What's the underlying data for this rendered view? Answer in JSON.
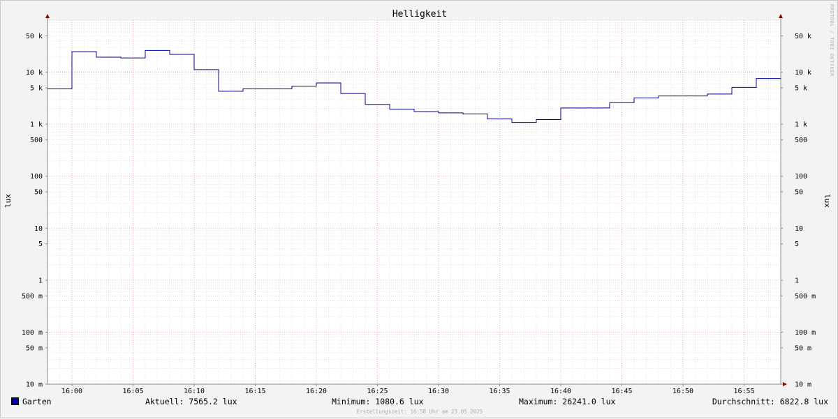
{
  "chart_data": {
    "type": "line",
    "title": "Helligkeit",
    "ylabel_left": "lux",
    "ylabel_right": "lux",
    "yscale": "log",
    "ylim": [
      0.01,
      100000
    ],
    "xlim": [
      "15:58",
      "17:58"
    ],
    "x_ticks": [
      "16:00",
      "16:05",
      "16:10",
      "16:15",
      "16:20",
      "16:25",
      "16:30",
      "16:35",
      "16:40",
      "16:45",
      "16:50",
      "16:55"
    ],
    "y_ticks": [
      {
        "value": 0.01,
        "label": "10 m"
      },
      {
        "value": 0.05,
        "label": "50 m"
      },
      {
        "value": 0.1,
        "label": "100 m"
      },
      {
        "value": 0.5,
        "label": "500 m"
      },
      {
        "value": 1,
        "label": "1"
      },
      {
        "value": 5,
        "label": "5"
      },
      {
        "value": 10,
        "label": "10"
      },
      {
        "value": 50,
        "label": "50"
      },
      {
        "value": 100,
        "label": "100"
      },
      {
        "value": 500,
        "label": "500"
      },
      {
        "value": 1000,
        "label": "1 k"
      },
      {
        "value": 5000,
        "label": "5 k"
      },
      {
        "value": 10000,
        "label": "10 k"
      },
      {
        "value": 50000,
        "label": "50 k"
      }
    ],
    "grid": true,
    "series": [
      {
        "name": "Garten",
        "color": "#000099",
        "step": true,
        "points": [
          {
            "t": "15:58",
            "v": 4800
          },
          {
            "t": "16:00",
            "v": 24800
          },
          {
            "t": "16:02",
            "v": 19500
          },
          {
            "t": "16:04",
            "v": 18800
          },
          {
            "t": "16:06",
            "v": 26241
          },
          {
            "t": "16:08",
            "v": 22000
          },
          {
            "t": "16:10",
            "v": 11200
          },
          {
            "t": "16:12",
            "v": 4300
          },
          {
            "t": "16:14",
            "v": 4800
          },
          {
            "t": "16:18",
            "v": 5400
          },
          {
            "t": "16:20",
            "v": 6200
          },
          {
            "t": "16:22",
            "v": 3900
          },
          {
            "t": "16:24",
            "v": 2400
          },
          {
            "t": "16:26",
            "v": 1950
          },
          {
            "t": "16:28",
            "v": 1750
          },
          {
            "t": "16:30",
            "v": 1650
          },
          {
            "t": "16:32",
            "v": 1580
          },
          {
            "t": "16:34",
            "v": 1260
          },
          {
            "t": "16:36",
            "v": 1080.6
          },
          {
            "t": "16:38",
            "v": 1230
          },
          {
            "t": "16:40",
            "v": 2050
          },
          {
            "t": "16:44",
            "v": 2600
          },
          {
            "t": "16:46",
            "v": 3200
          },
          {
            "t": "16:48",
            "v": 3500
          },
          {
            "t": "16:52",
            "v": 3800
          },
          {
            "t": "16:54",
            "v": 5100
          },
          {
            "t": "16:56",
            "v": 7565.2
          },
          {
            "t": "16:58",
            "v": 7565.2
          }
        ]
      }
    ],
    "legend": {
      "name": "Garten",
      "current": "Aktuell: 7565.2 lux",
      "minimum": "Minimum: 1080.6 lux",
      "maximum": "Maximum: 26241.0 lux",
      "average": "Durchschnitt: 6822.8 lux"
    },
    "footer": "Erstellungszeit: 16:58 Uhr am 23.05.2025",
    "watermark": "RRDTOOL / TOBI OETIKER",
    "colors": {
      "line": "#000099",
      "major_grid": "#e8a0a8",
      "minor_grid": "#d0d0d0",
      "axis": "#888888",
      "arrow": "#990000"
    }
  }
}
